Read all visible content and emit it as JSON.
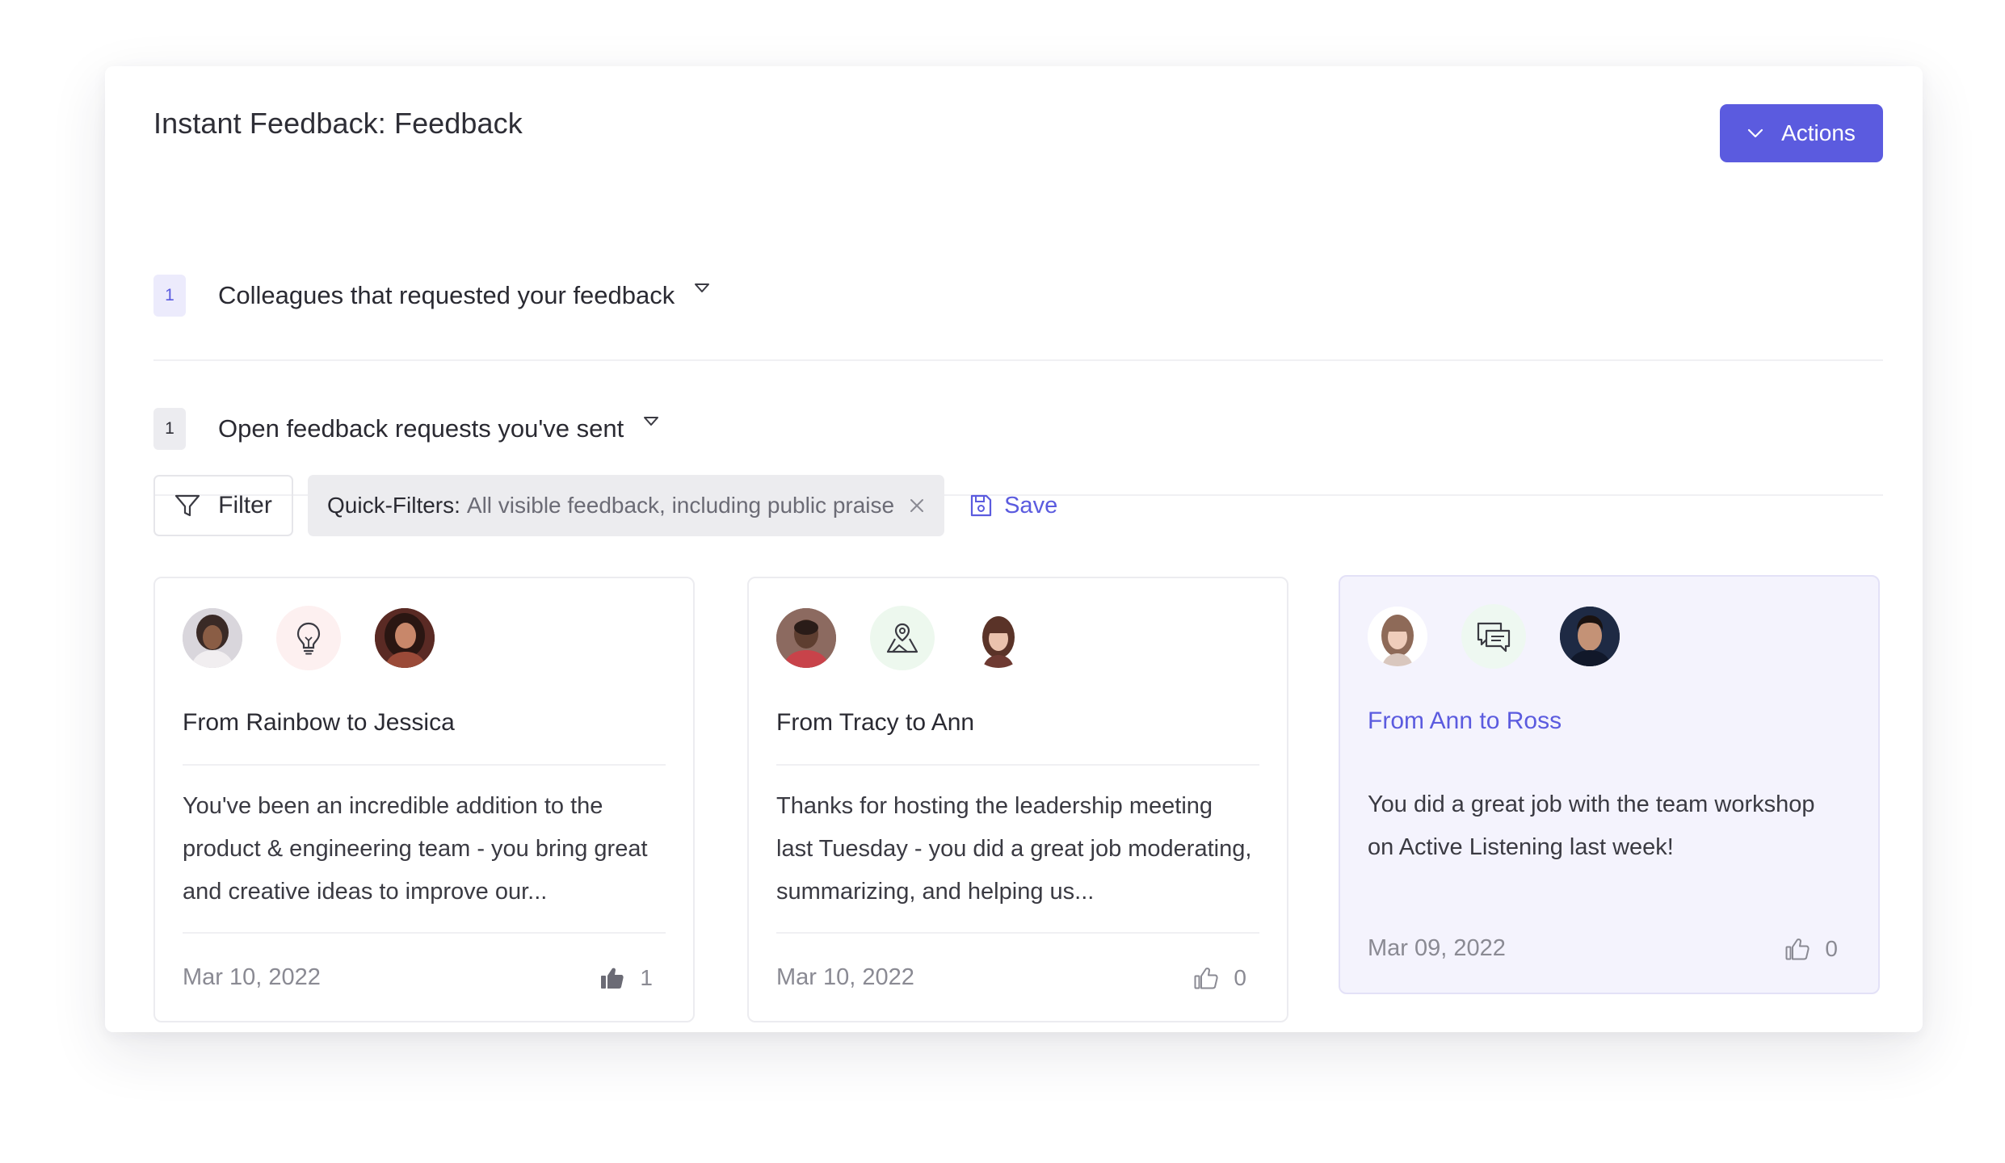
{
  "header": {
    "title": "Instant Feedback: Feedback",
    "actions_label": "Actions"
  },
  "sections": [
    {
      "count": "1",
      "label": "Colleagues that requested your feedback"
    },
    {
      "count": "1",
      "label": "Open feedback requests you've sent"
    }
  ],
  "filters": {
    "filter_label": "Filter",
    "quick_key": "Quick-Filters:",
    "quick_value": "All visible feedback, including public praise",
    "save_label": "Save"
  },
  "cards": [
    {
      "title": "From Rainbow to Jessica",
      "body": "You've been an incredible addition to the product & engineering team - you bring great and creative ideas to improve our...",
      "date": "Mar 10, 2022",
      "likes": "1",
      "icon": "lightbulb-icon"
    },
    {
      "title": "From Tracy to Ann",
      "body": "Thanks for hosting the leadership meeting last Tuesday - you did a great job moderating, summarizing, and helping us...",
      "date": "Mar 10, 2022",
      "likes": "0",
      "icon": "map-pin-icon"
    },
    {
      "title": "From Ann to Ross",
      "body": "You did a great job with the team workshop on Active Listening last week!",
      "date": "Mar 09, 2022",
      "likes": "0",
      "icon": "chat-bubbles-icon"
    }
  ],
  "colors": {
    "accent": "#5b5bdf",
    "highlight_card": "#f4f3fd",
    "muted_text": "#8a8a93"
  }
}
